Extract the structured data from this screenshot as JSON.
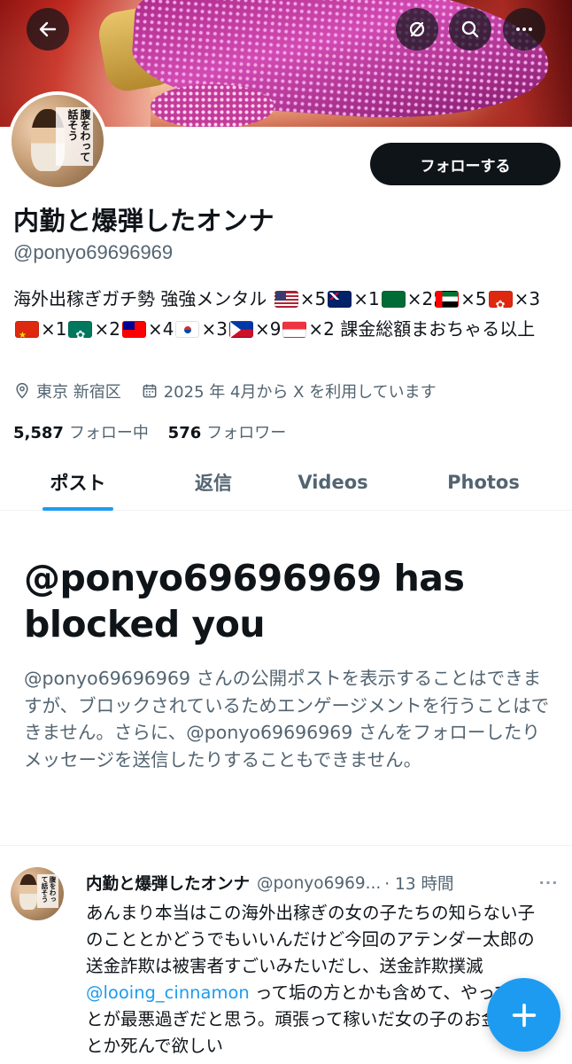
{
  "profile": {
    "display_name": "内勤と爆弾したオンナ",
    "handle": "@ponyo69696969",
    "follow_label": "フォローする",
    "avatar_text": "腹をわって話そう",
    "bio_segments": [
      {
        "text": "海外出稼ぎガチ勢 強強メンタル "
      },
      {
        "flag": "us"
      },
      {
        "text": "×5"
      },
      {
        "flag": "au"
      },
      {
        "text": "×1"
      },
      {
        "flag": "sa"
      },
      {
        "text": "×2"
      },
      {
        "flag": "ae"
      },
      {
        "text": "×5"
      },
      {
        "flag": "hk"
      },
      {
        "text": "×3"
      },
      {
        "flag": "cn"
      },
      {
        "text": "×1"
      },
      {
        "flag": "mo"
      },
      {
        "text": "×2"
      },
      {
        "flag": "tw"
      },
      {
        "text": "×4"
      },
      {
        "flag": "kr"
      },
      {
        "text": "×3"
      },
      {
        "flag": "ph"
      },
      {
        "text": "×9"
      },
      {
        "flag": "sg"
      },
      {
        "text": "×2 課金総額まおちゃる以上"
      }
    ],
    "location": "東京 新宿区",
    "joined": "2025 年 4月から X を利用しています",
    "following_count": "5,587",
    "following_label": "フォロー中",
    "followers_count": "576",
    "followers_label": "フォロワー"
  },
  "tabs": [
    {
      "label": "ポスト",
      "active": true
    },
    {
      "label": "返信",
      "active": false
    },
    {
      "label": "Videos",
      "active": false
    },
    {
      "label": "Photos",
      "active": false
    }
  ],
  "blocked": {
    "title": "@ponyo69696969 has blocked you",
    "body": "@ponyo69696969 さんの公開ポストを表示することはできますが、ブロックされているためエンゲージメントを行うことはできません。さらに、@ponyo69696969 さんをフォローしたりメッセージを送信したりすることもできません。"
  },
  "post": {
    "name": "内勤と爆弾したオンナ",
    "handle": "@ponyo6969...",
    "time": "· 13 時間",
    "text_before_mention": "あんまり本当はこの海外出稼ぎの女の子たちの知らない子のこととかどうでもいいんだけど今回のアテンダー太郎の送金詐欺は被害者すごいみたいだし、送金詐欺撲滅 ",
    "mention": "@looing_cinnamon",
    "text_after_mention": " って垢の方とかも含めて、やってることが最悪過ぎだと思う。頑張って稼いだ女の子のお金取る奴とか死んで欲しい"
  },
  "icons": {
    "back": "arrow-left-icon",
    "grok": "grok-icon",
    "search": "search-icon",
    "more": "more-horizontal-icon",
    "location": "location-pin-icon",
    "calendar": "calendar-icon",
    "compose": "plus-icon"
  },
  "colors": {
    "accent": "#1d9bf0",
    "text_primary": "#0f1419",
    "text_secondary": "#536471",
    "follow_button_bg": "#0f1419"
  }
}
